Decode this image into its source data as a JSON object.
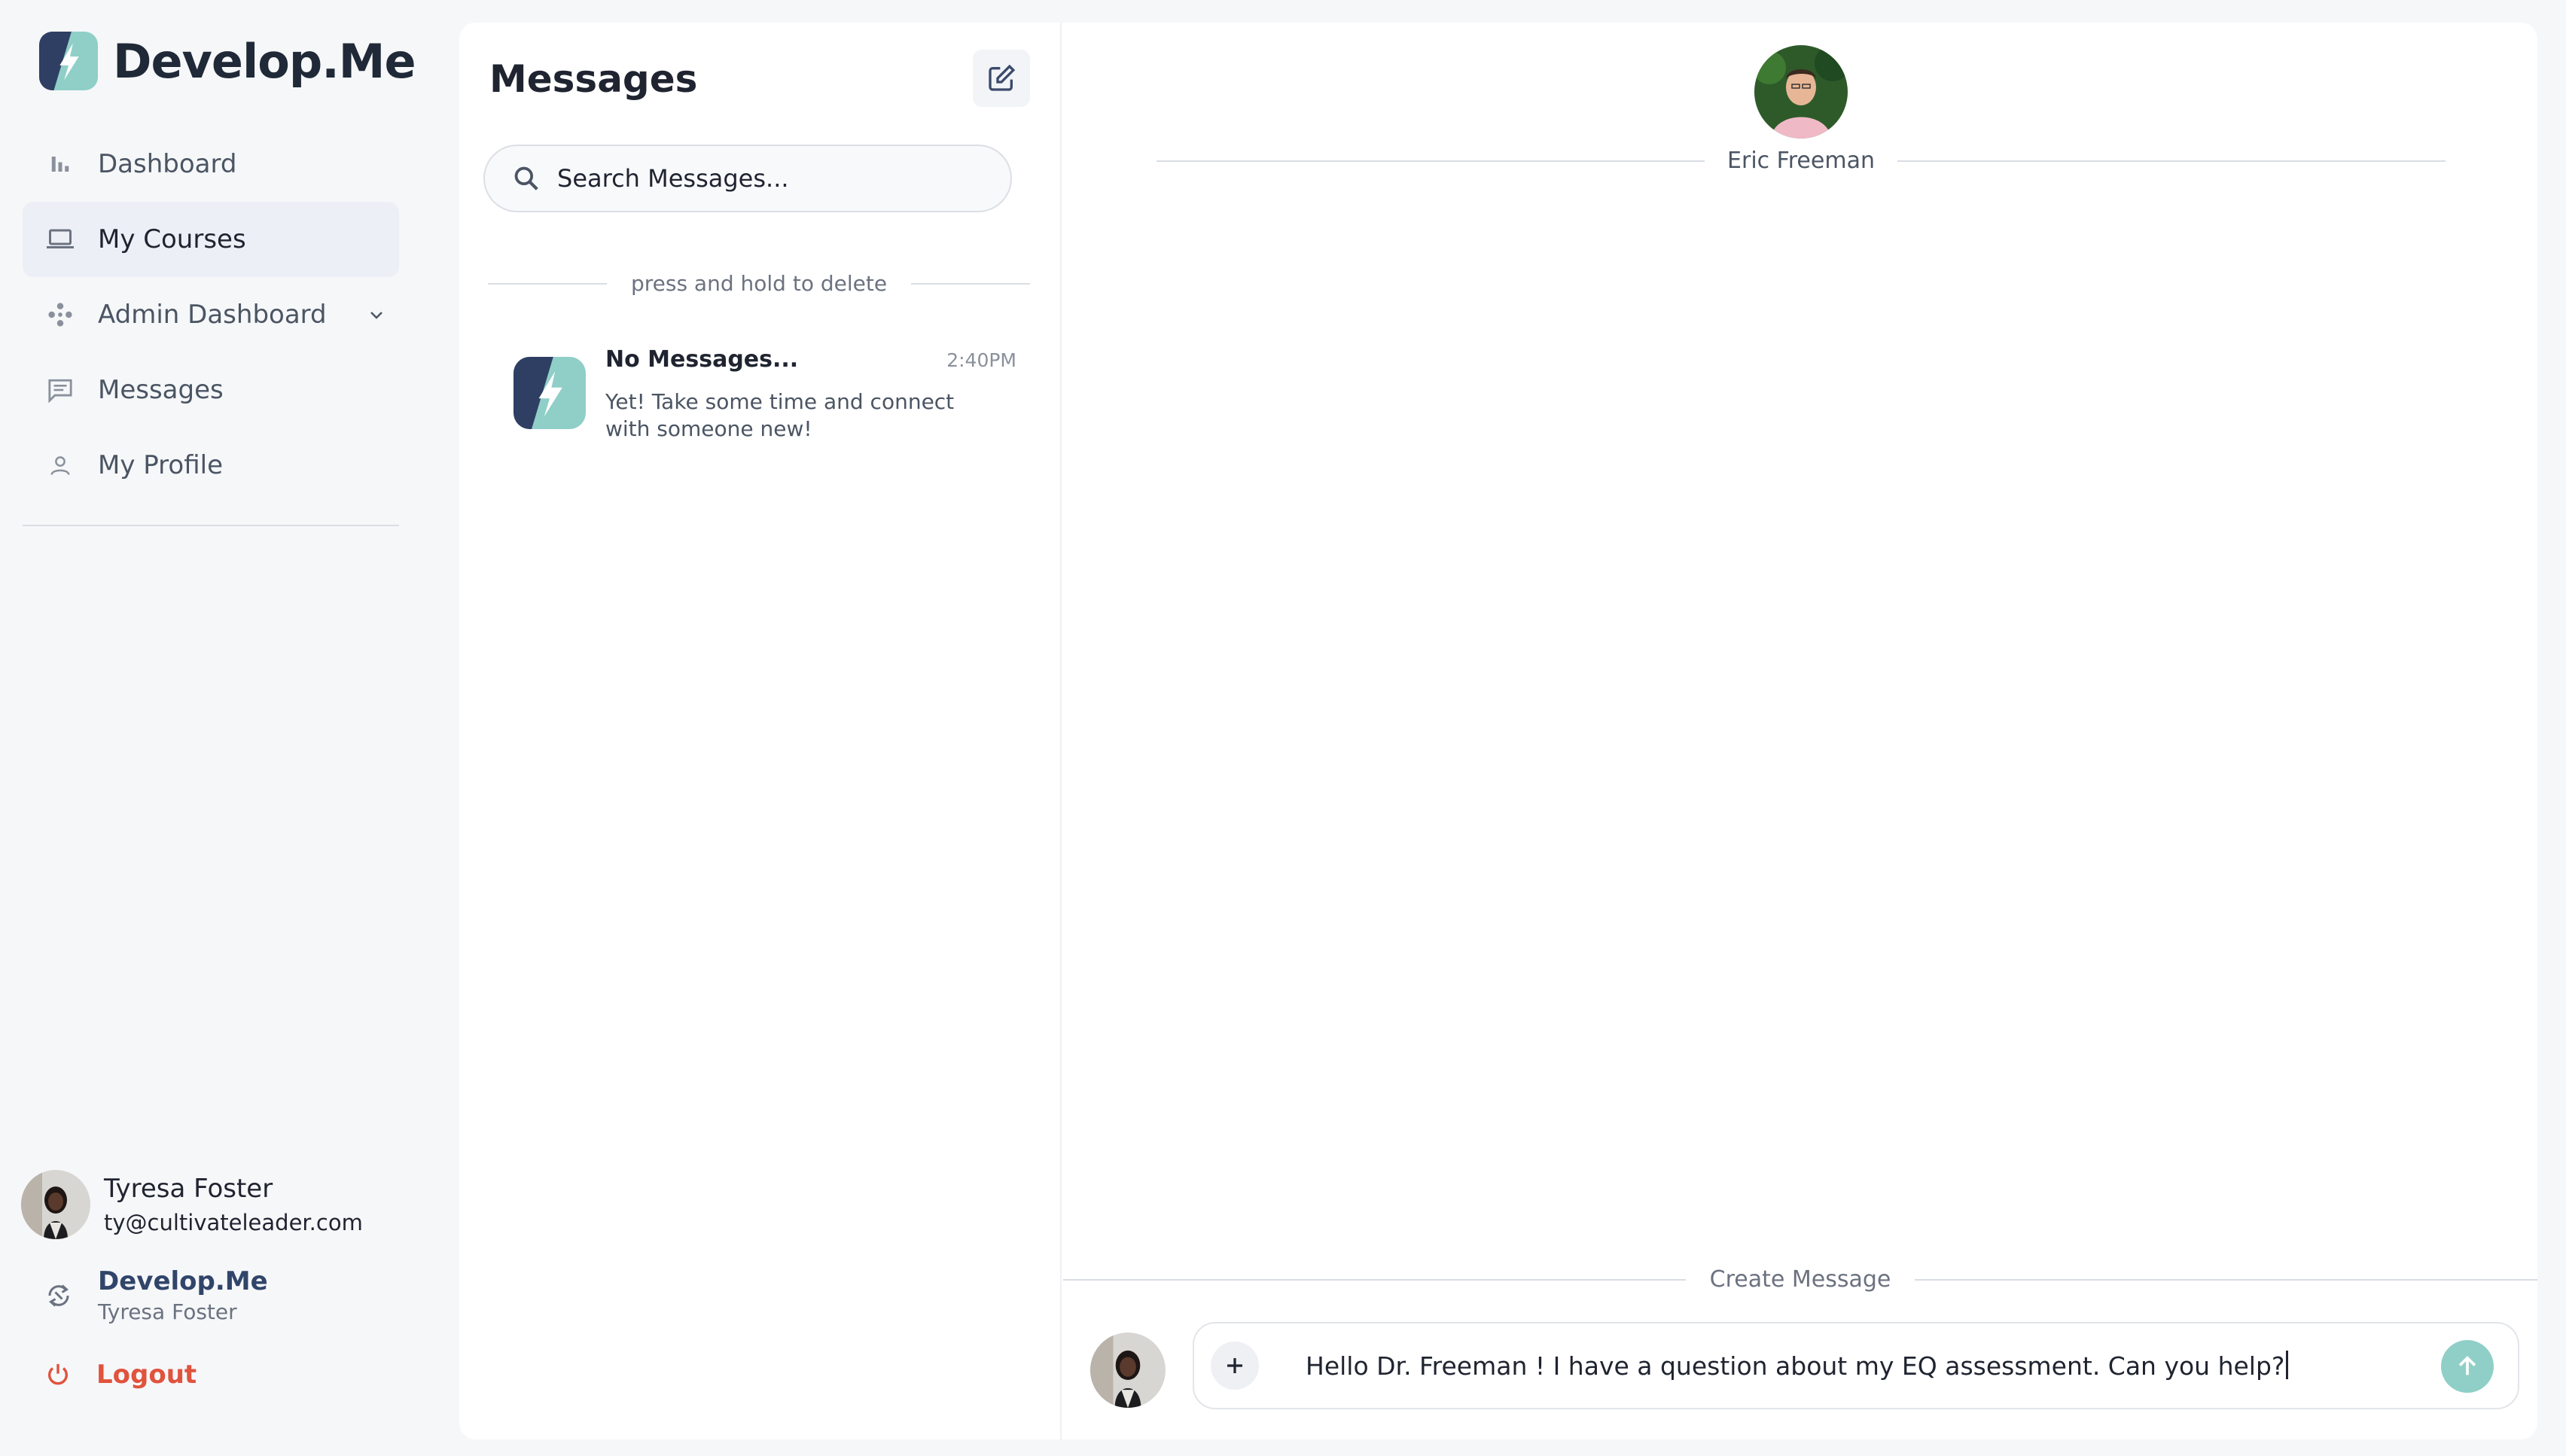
{
  "brand": {
    "name": "Develop.Me"
  },
  "nav": {
    "items": [
      {
        "label": "Dashboard",
        "icon": "bar-chart-icon"
      },
      {
        "label": "My Courses",
        "icon": "laptop-icon",
        "active": true
      },
      {
        "label": "Admin Dashboard",
        "icon": "admin-icon",
        "expandable": true
      },
      {
        "label": "Messages",
        "icon": "chat-icon"
      },
      {
        "label": "My Profile",
        "icon": "person-icon"
      }
    ]
  },
  "user": {
    "name": "Tyresa Foster",
    "email": "ty@cultivateleader.com"
  },
  "org": {
    "name": "Develop.Me",
    "member": "Tyresa Foster"
  },
  "logout": {
    "label": "Logout"
  },
  "messages": {
    "title": "Messages",
    "search_placeholder": "Search Messages...",
    "hint": "press and hold to delete",
    "conversations": [
      {
        "name": "No Messages...",
        "time": "2:40PM",
        "preview": "Yet! Take some time and connect with someone new!"
      }
    ]
  },
  "chat": {
    "contact_name": "Eric Freeman",
    "create_label": "Create Message",
    "draft": "Hello Dr. Freeman ! I have a question about my EQ assessment. Can you help?"
  },
  "colors": {
    "accent_teal": "#8fcfc7",
    "logo_navy": "#2f3f63",
    "logout_red": "#e0533d"
  }
}
